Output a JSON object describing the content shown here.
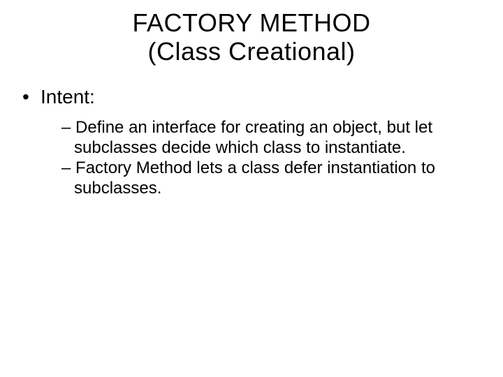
{
  "title_line1": "FACTORY METHOD",
  "title_line2": "(Class Creational)",
  "heading": {
    "bullet": "•",
    "text": "Intent:"
  },
  "points": [
    {
      "bullet": "–",
      "text": "Define an interface for creating an object, but let subclasses decide which class to instantiate."
    },
    {
      "bullet": "–",
      "text": "Factory Method lets a class defer instantiation to subclasses."
    }
  ]
}
